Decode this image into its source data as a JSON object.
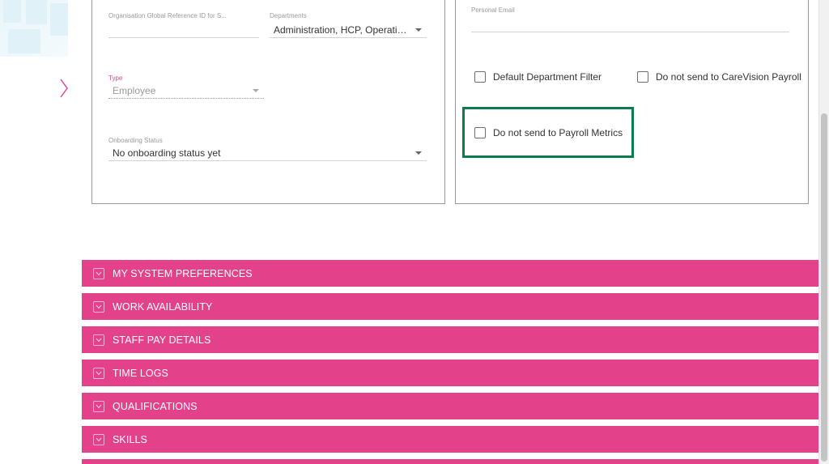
{
  "left_panel": {
    "org_ref": {
      "label": "Organisation Global Reference ID for S...",
      "value": ""
    },
    "departments": {
      "label": "Departments",
      "value": "Administration, HCP, Operation..."
    },
    "type": {
      "label": "Type",
      "value": "Employee"
    },
    "onboarding": {
      "label": "Onboarding Status",
      "value": "No onboarding status yet"
    }
  },
  "right_panel": {
    "personal_email": {
      "label": "Personal Email",
      "value": ""
    },
    "checkboxes": {
      "default_department_filter": {
        "label": "Default Department Filter",
        "checked": false
      },
      "no_carevision_payroll": {
        "label": "Do not send to CareVision Payroll",
        "checked": false
      },
      "no_payroll_metrics": {
        "label": "Do not send to Payroll Metrics",
        "checked": false
      }
    }
  },
  "sections": [
    {
      "title": "MY SYSTEM PREFERENCES"
    },
    {
      "title": "WORK AVAILABILITY"
    },
    {
      "title": "STAFF PAY DETAILS"
    },
    {
      "title": "TIME LOGS"
    },
    {
      "title": "QUALIFICATIONS"
    },
    {
      "title": "SKILLS"
    },
    {
      "title": ""
    }
  ],
  "icons": {
    "side_nav": "chevron-right-icon",
    "section_toggle": "chevron-down-icon"
  },
  "colors": {
    "accent_pink": "#e4418b",
    "highlight_green": "#0a7c4e",
    "panel_border": "#9a9a9a"
  }
}
